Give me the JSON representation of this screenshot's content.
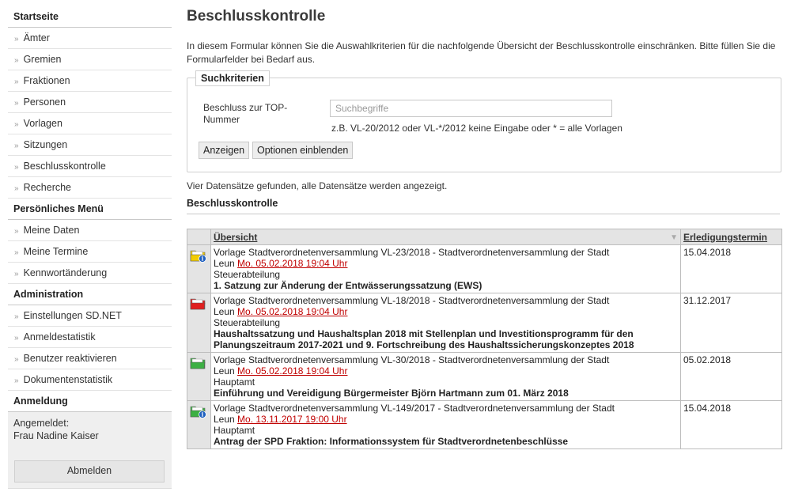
{
  "sidebar": {
    "sections": [
      {
        "title": "Startseite",
        "items": [
          "Ämter",
          "Gremien",
          "Fraktionen",
          "Personen",
          "Vorlagen",
          "Sitzungen",
          "Beschlusskontrolle",
          "Recherche"
        ]
      },
      {
        "title": "Persönliches Menü",
        "items": [
          "Meine Daten",
          "Meine Termine",
          "Kennwortänderung"
        ]
      },
      {
        "title": "Administration",
        "items": [
          "Einstellungen SD.NET",
          "Anmeldestatistik",
          "Benutzer reaktivieren",
          "Dokumentenstatistik"
        ]
      },
      {
        "title": "Anmeldung",
        "items": []
      }
    ],
    "login": {
      "label": "Angemeldet:",
      "user": "Frau Nadine Kaiser",
      "logout": "Abmelden"
    },
    "chevron": "»"
  },
  "main": {
    "title": "Beschlusskontrolle",
    "intro": "In diesem Formular können Sie die Auswahlkriterien für die nachfolgende Übersicht der Beschlusskontrolle einschränken. Bitte füllen Sie die Formularfelder bei Bedarf aus.",
    "form": {
      "legend": "Suchkriterien",
      "field_label": "Beschluss zur TOP-Nummer",
      "placeholder": "Suchbegriffe",
      "hint": "z.B. VL-20/2012 oder VL-*/2012 keine Eingabe oder * = alle Vorlagen",
      "btn_show": "Anzeigen",
      "btn_options": "Optionen einblenden"
    },
    "found_text": "Vier Datensätze gefunden, alle Datensätze werden angezeigt.",
    "section_title": "Beschlusskontrolle"
  },
  "table": {
    "headers": [
      "Übersicht",
      "Erledigungstermin"
    ],
    "rows": [
      {
        "icon": "folder-yellow-info-icon",
        "color": "#f2cc00",
        "info": true,
        "line1": "Vorlage Stadtverordnetenversammlung VL-23/2018 - Stadtverordnetenversammlung der Stadt",
        "prefix": "Leun",
        "date": "Mo. 05.02.2018 19:04 Uhr",
        "dept": "Steuerabteilung",
        "topic": "1. Satzung zur Änderung der Entwässerungssatzung (EWS)",
        "due": "15.04.2018"
      },
      {
        "icon": "folder-red-icon",
        "color": "#e02020",
        "info": false,
        "line1": "Vorlage Stadtverordnetenversammlung VL-18/2018 - Stadtverordnetenversammlung der Stadt",
        "prefix": "Leun",
        "date": "Mo. 05.02.2018 19:04 Uhr",
        "dept": "Steuerabteilung",
        "topic": "Haushaltssatzung und Haushaltsplan 2018 mit Stellenplan und Investitionsprogramm für den Planungszeitraum 2017-2021 und 9. Fortschreibung des Haushaltssicherungskonzeptes 2018",
        "due": "31.12.2017"
      },
      {
        "icon": "folder-green-icon",
        "color": "#3cb043",
        "info": false,
        "line1": "Vorlage Stadtverordnetenversammlung VL-30/2018 - Stadtverordnetenversammlung der Stadt",
        "prefix": "Leun",
        "date": "Mo. 05.02.2018 19:04 Uhr",
        "dept": "Hauptamt",
        "topic": "Einführung und Vereidigung Bürgermeister Björn Hartmann zum 01. März 2018",
        "due": "05.02.2018"
      },
      {
        "icon": "folder-green-info-icon",
        "color": "#3cb043",
        "info": true,
        "line1": "Vorlage Stadtverordnetenversammlung VL-149/2017 - Stadtverordnetenversammlung der Stadt",
        "prefix": "Leun",
        "date": "Mo. 13.11.2017 19:00 Uhr",
        "dept": "Hauptamt",
        "topic": "Antrag der SPD Fraktion: Informationssystem für Stadtverordnetenbeschlüsse",
        "due": "15.04.2018"
      }
    ]
  }
}
